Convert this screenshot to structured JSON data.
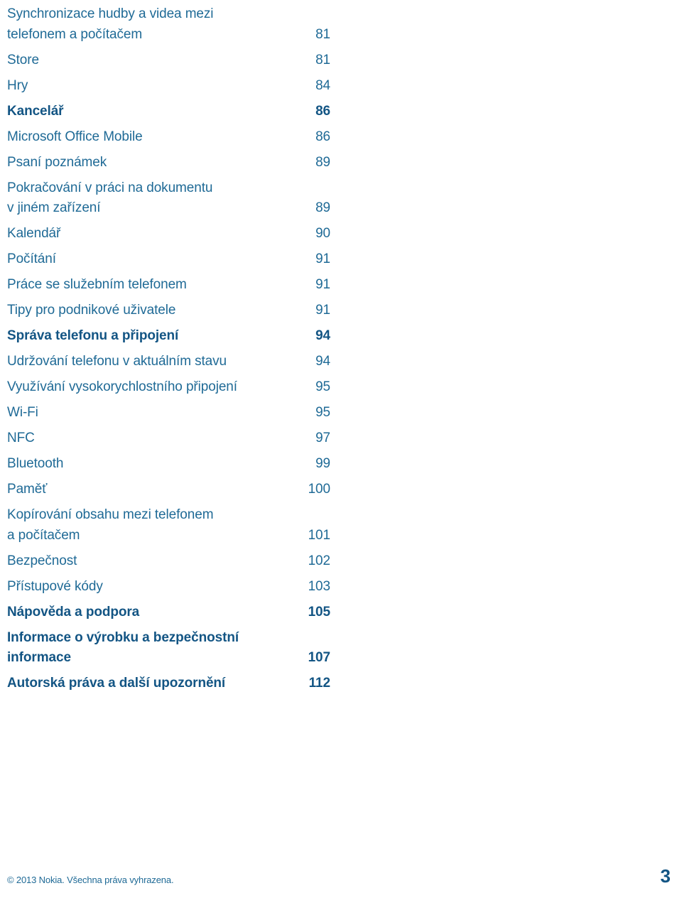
{
  "document": {
    "language": "cs",
    "kind": "table-of-contents"
  },
  "colors": {
    "entry_text": "#1f6a96",
    "heading_text": "#135584",
    "background": "#ffffff"
  },
  "toc": {
    "entries": [
      {
        "title": "Synchronizace hudby a videa mezi\ntelefonem a počítačem",
        "page": "81",
        "level": "entry"
      },
      {
        "title": "Store",
        "page": "81",
        "level": "entry"
      },
      {
        "title": "Hry",
        "page": "84",
        "level": "entry"
      },
      {
        "title": "Kancelář",
        "page": "86",
        "level": "head"
      },
      {
        "title": "Microsoft Office Mobile",
        "page": "86",
        "level": "entry"
      },
      {
        "title": "Psaní poznámek",
        "page": "89",
        "level": "entry"
      },
      {
        "title": "Pokračování v práci na dokumentu\nv jiném zařízení",
        "page": "89",
        "level": "entry"
      },
      {
        "title": "Kalendář",
        "page": "90",
        "level": "entry"
      },
      {
        "title": "Počítání",
        "page": "91",
        "level": "entry"
      },
      {
        "title": "Práce se služebním telefonem",
        "page": "91",
        "level": "entry"
      },
      {
        "title": "Tipy pro podnikové uživatele",
        "page": "91",
        "level": "entry"
      },
      {
        "title": "Správa telefonu a připojení",
        "page": "94",
        "level": "head"
      },
      {
        "title": "Udržování telefonu v aktuálním stavu",
        "page": "94",
        "level": "entry"
      },
      {
        "title": "Využívání vysokorychlostního připojení",
        "page": "95",
        "level": "entry"
      },
      {
        "title": "Wi-Fi",
        "page": "95",
        "level": "entry"
      },
      {
        "title": "NFC",
        "page": "97",
        "level": "entry"
      },
      {
        "title": "Bluetooth",
        "page": "99",
        "level": "entry"
      },
      {
        "title": "Paměť",
        "page": "100",
        "level": "entry"
      },
      {
        "title": "Kopírování obsahu mezi telefonem\na počítačem",
        "page": "101",
        "level": "entry"
      },
      {
        "title": "Bezpečnost",
        "page": "102",
        "level": "entry"
      },
      {
        "title": "Přístupové kódy",
        "page": "103",
        "level": "entry"
      },
      {
        "title": "Nápověda a podpora",
        "page": "105",
        "level": "head"
      },
      {
        "title": "Informace o výrobku a bezpečnostní\ninformace",
        "page": "107",
        "level": "head"
      },
      {
        "title": "Autorská práva a další upozornění",
        "page": "112",
        "level": "head"
      }
    ]
  },
  "footer": {
    "copyright": "© 2013 Nokia. Všechna práva vyhrazena.",
    "page_number": "3"
  }
}
